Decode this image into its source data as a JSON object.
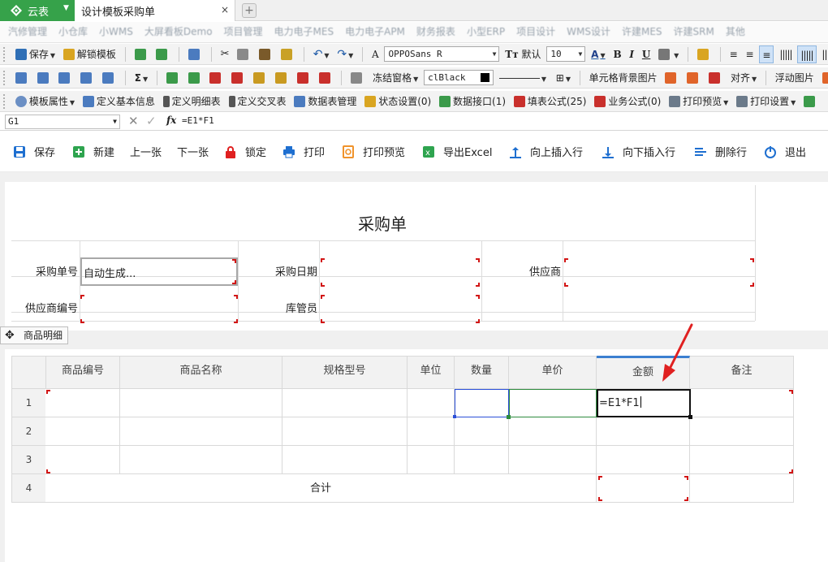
{
  "app": {
    "name": "云表",
    "tab_title": "设计模板采购单",
    "close_glyph": "×",
    "new_tab_glyph": "+"
  },
  "nav_items": [
    "汽修管理",
    "小仓库",
    "小WMS",
    "大屏看板Demo",
    "项目管理",
    "电力电子MES",
    "电力电子APM",
    "财务报表",
    "小型ERP",
    "项目设计",
    "WMS设计",
    "许建MES",
    "许建SRM",
    "其他"
  ],
  "toolbar1": {
    "save": "保存",
    "unlock_template": "解锁模板",
    "font": "OPPOSans R",
    "default": "默认",
    "font_size": "10",
    "bold": "B",
    "italic": "I",
    "underline": "U"
  },
  "toolbar2": {
    "sigma": "Σ",
    "freeze": "冻结窗格",
    "color_name": "clBlack",
    "cell_bg_image": "单元格背景图片",
    "align": "对齐",
    "float_image": "浮动图片",
    "float_more": "浮动"
  },
  "toolbar3": {
    "template_props": "模板属性",
    "define_basic": "定义基本信息",
    "define_detail": "定义明细表",
    "define_cross": "定义交叉表",
    "data_table_mgmt": "数据表管理",
    "status_setting": "状态设置(0)",
    "data_interface": "数据接口(1)",
    "fill_formula": "填表公式(25)",
    "business_formula": "业务公式(0)",
    "print_preview": "打印预览",
    "print_setting": "打印设置"
  },
  "formula_bar": {
    "cell_ref": "G1",
    "formula": "=E1*F1"
  },
  "actions": [
    "保存",
    "新建",
    "上一张",
    "下一张",
    "锁定",
    "打印",
    "打印预览",
    "导出Excel",
    "向上插入行",
    "向下插入行",
    "删除行",
    "退出"
  ],
  "form": {
    "title": "采购单",
    "labels": {
      "order_no": "采购单号",
      "order_date": "采购日期",
      "supplier": "供应商",
      "supplier_no": "供应商编号",
      "keeper": "库管员"
    },
    "order_no_value": "自动生成..."
  },
  "detail_tab": "商品明细",
  "grid": {
    "headers": [
      "商品编号",
      "商品名称",
      "规格型号",
      "单位",
      "数量",
      "单价",
      "金额",
      "备注"
    ],
    "row_numbers": [
      "1",
      "2",
      "3",
      "4"
    ],
    "editing_value": "=E1*F1",
    "total_label": "合计"
  },
  "colors": {
    "brand_green": "#36a24a",
    "accent_blue": "#1e5aa8",
    "arrow_red": "#e02020"
  }
}
